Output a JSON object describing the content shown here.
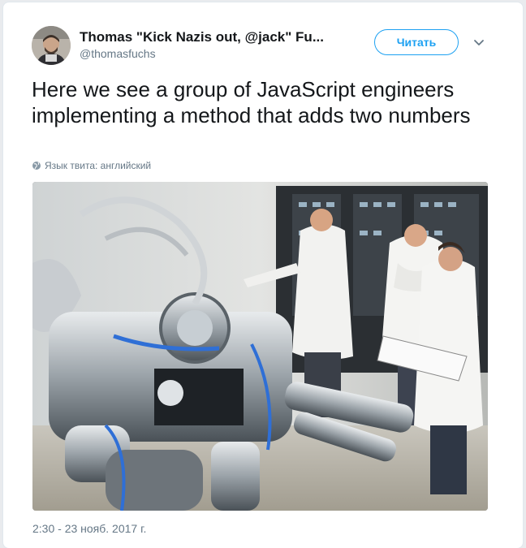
{
  "tweet": {
    "display_name": "Thomas \"Kick Nazis out, @jack\" Fu...",
    "handle": "@thomasfuchs",
    "follow_label": "Читать",
    "text": "Here we see a group of JavaScript engineers implementing a method that adds two numbers",
    "language_note": "Язык твита: английский",
    "timestamp": "2:30 - 23 нояб. 2017 г."
  },
  "icons": {
    "avatar": "user-avatar-photo",
    "caret": "chevron-down-icon",
    "globe": "globe-icon",
    "photo": "lab-equipment-photo"
  },
  "colors": {
    "accent": "#1da1f2",
    "secondary_text": "#657786",
    "primary_text": "#14171a"
  }
}
